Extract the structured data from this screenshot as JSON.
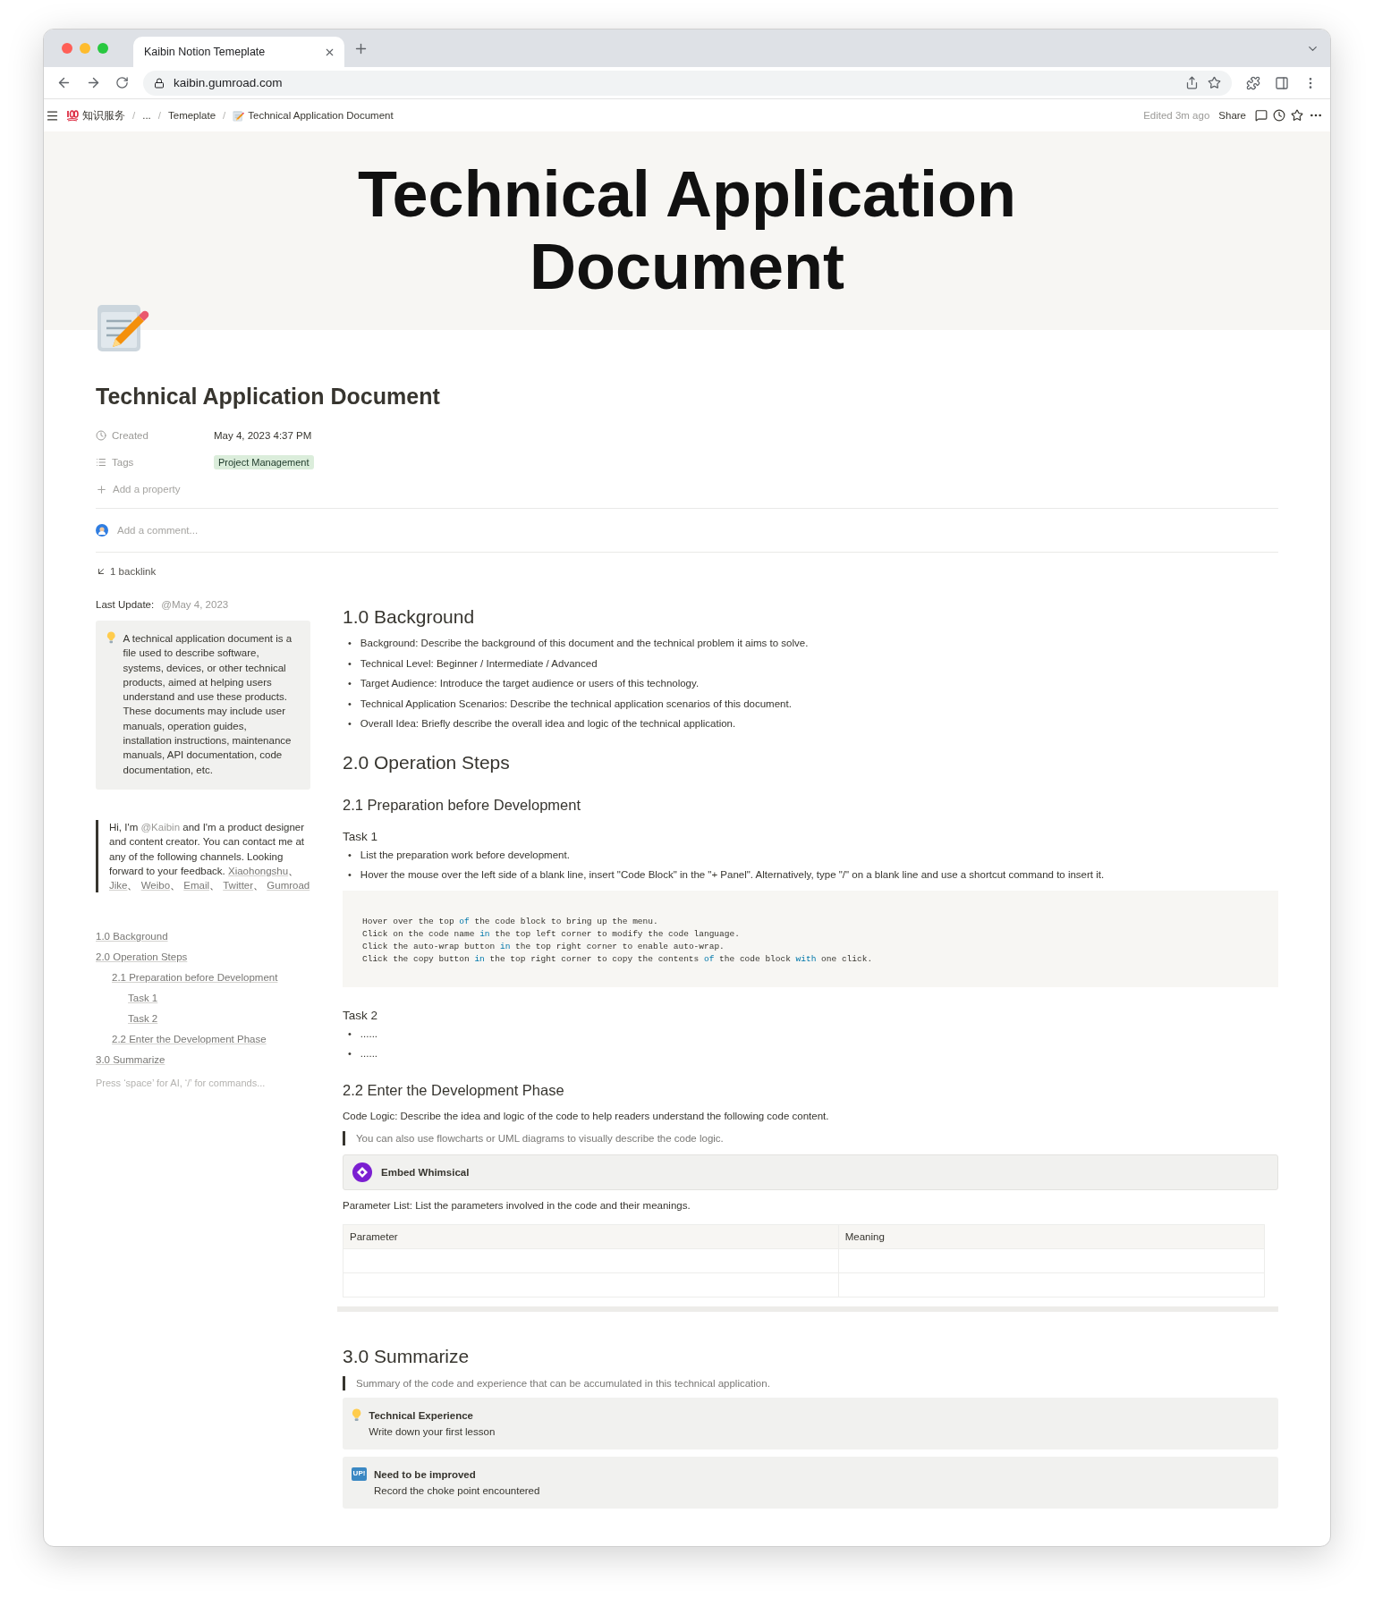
{
  "browser": {
    "tab_title": "Kaibin Notion Temeplate",
    "url": "kaibin.gumroad.com"
  },
  "topbar": {
    "breadcrumbs": [
      {
        "kind": "workspace",
        "label": "知识服务"
      },
      {
        "kind": "plain",
        "label": "..."
      },
      {
        "kind": "plain",
        "label": "Temeplate"
      },
      {
        "kind": "current",
        "label": "Technical Application Document"
      }
    ],
    "separator": "/",
    "edited": "Edited 3m ago",
    "share": "Share"
  },
  "cover": {
    "title": "Technical Application Document"
  },
  "page": {
    "title": "Technical Application Document",
    "properties": [
      {
        "kind": "date",
        "name": "Created",
        "value": "May 4, 2023 4:37 PM"
      },
      {
        "kind": "tags",
        "name": "Tags",
        "tags": [
          "Project Management"
        ]
      }
    ],
    "add_property": "Add a property",
    "comment_placeholder": "Add a comment...",
    "backlinks": "1 backlink"
  },
  "sidebar": {
    "last_update_label": "Last Update:",
    "last_update_value": "@May 4, 2023",
    "callout": "A technical application document is a file used to describe software, systems, devices, or other technical products, aimed at helping users understand and use these products. These documents may include user manuals, operation guides, installation instructions, maintenance manuals, API documentation, code documentation, etc.",
    "contact": {
      "before": "Hi, I'm ",
      "mention": "@Kaibin",
      "after": " and I'm a product designer and content creator. You can contact me at any of the following channels. Looking forward to your feedback.",
      "separator": "、",
      "links": [
        "Xiaohongshu",
        "Jike",
        "Weibo",
        "Email",
        "Twitter",
        "Gumroad"
      ]
    },
    "toc": [
      {
        "label": "1.0 Background"
      },
      {
        "label": "2.0 Operation Steps",
        "children": [
          {
            "label": "2.1 Preparation before Development",
            "children": [
              {
                "label": "Task 1"
              },
              {
                "label": "Task 2"
              }
            ]
          },
          {
            "label": "2.2 Enter the Development Phase"
          }
        ]
      },
      {
        "label": "3.0 Summarize"
      }
    ],
    "placeholder": "Press ‘space’ for AI, ‘/’ for commands..."
  },
  "blocks": [
    {
      "kind": "h1",
      "text": "1.0 Background"
    },
    {
      "kind": "bullets",
      "marker": "•",
      "items": [
        "Background: Describe the background of this document and the technical problem it aims to solve.",
        "Technical Level: Beginner / Intermediate / Advanced",
        "Target Audience: Introduce the target audience or users of this technology.",
        "Technical Application Scenarios: Describe the technical application scenarios of this document.",
        "Overall Idea: Briefly describe the overall idea and logic of the technical application."
      ]
    },
    {
      "kind": "h1",
      "text": "2.0 Operation Steps"
    },
    {
      "kind": "h2",
      "text": "2.1 Preparation before Development"
    },
    {
      "kind": "h3",
      "text": "Task 1"
    },
    {
      "kind": "bullets",
      "marker": "•",
      "items": [
        "List the preparation work before development.",
        "Hover the mouse over the left side of a blank line, insert \"Code Block\" in the \"+ Panel\". Alternatively, type \"/\" on a blank line and use a shortcut command to insert it."
      ]
    },
    {
      "kind": "code",
      "lines": [
        [
          "Hover over the top ",
          "of",
          " the code block to bring up the menu."
        ],
        [
          "Click on the code name ",
          "in",
          " the top left corner to modify the code language."
        ],
        [
          "Click the auto-wrap button ",
          "in",
          " the top right corner to enable auto-wrap."
        ],
        [
          "Click the copy button ",
          "in",
          " the top right corner to copy the contents ",
          "of",
          " the code block ",
          "with",
          " one click."
        ]
      ]
    },
    {
      "kind": "h3",
      "text": "Task 2"
    },
    {
      "kind": "bullets",
      "marker": "•",
      "items": [
        "......",
        "......"
      ]
    },
    {
      "kind": "h2",
      "text": "2.2 Enter the Development Phase"
    },
    {
      "kind": "text",
      "text": "Code Logic: Describe the idea and logic of the code to help readers understand the following code content."
    },
    {
      "kind": "quote",
      "text": "You can also use flowcharts or UML diagrams to visually describe the code logic."
    },
    {
      "kind": "embed",
      "text": "Embed Whimsical"
    },
    {
      "kind": "text",
      "text": "Parameter List: List the parameters involved in the code and their meanings."
    },
    {
      "kind": "table",
      "columns": [
        "Parameter",
        "Meaning"
      ]
    },
    {
      "kind": "divider"
    },
    {
      "kind": "h1",
      "text": "3.0 Summarize"
    },
    {
      "kind": "quote",
      "text": "Summary of the code and experience that can be accumulated in this technical application."
    },
    {
      "kind": "tip_callout",
      "title": "Technical Experience",
      "text": "Write down your first lesson"
    },
    {
      "kind": "badge_callout",
      "badge": "UP!",
      "title": "Need to be improved",
      "text": "Record the choke point encountered"
    }
  ]
}
